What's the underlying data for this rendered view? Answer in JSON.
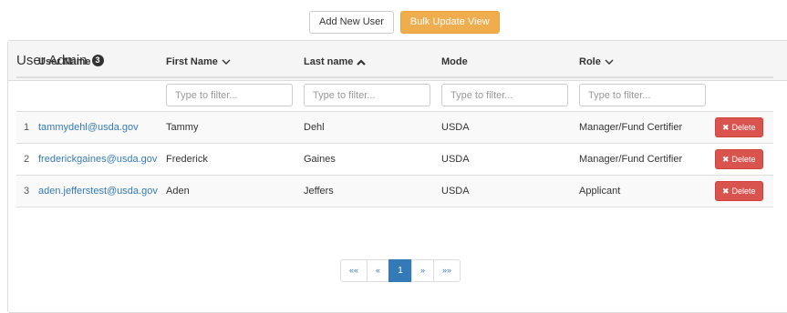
{
  "toolbar": {
    "add_user_label": "Add New User",
    "bulk_update_label": "Bulk Update View"
  },
  "panel": {
    "title": "User Admin",
    "count": "3"
  },
  "table": {
    "columns": [
      {
        "label": "User Name",
        "sort": "none"
      },
      {
        "label": "First Name",
        "sort": "chevron-down"
      },
      {
        "label": "Last name",
        "sort": "caret-up"
      },
      {
        "label": "Mode",
        "sort": "none"
      },
      {
        "label": "Role",
        "sort": "chevron-down"
      }
    ],
    "filter_placeholders": [
      "Type to filter...",
      "Type to filter...",
      "Type to filter...",
      "Type to filter..."
    ],
    "rows": [
      {
        "index": "1",
        "email": "tammydehl@usda.gov",
        "first": "Tammy",
        "last": "Dehl",
        "mode": "USDA",
        "role": "Manager/Fund Certifier",
        "action": "Delete"
      },
      {
        "index": "2",
        "email": "frederickgaines@usda.gov",
        "first": "Frederick",
        "last": "Gaines",
        "mode": "USDA",
        "role": "Manager/Fund Certifier",
        "action": "Delete"
      },
      {
        "index": "3",
        "email": "aden.jefferstest@usda.gov",
        "first": "Aden",
        "last": "Jeffers",
        "mode": "USDA",
        "role": "Applicant",
        "action": "Delete"
      }
    ]
  },
  "pagination": {
    "first": "««",
    "prev": "«",
    "current": "1",
    "next": "»",
    "last": "»»"
  },
  "colors": {
    "primary": "#337ab7",
    "warning": "#f0ad4e",
    "danger": "#d9534f"
  }
}
